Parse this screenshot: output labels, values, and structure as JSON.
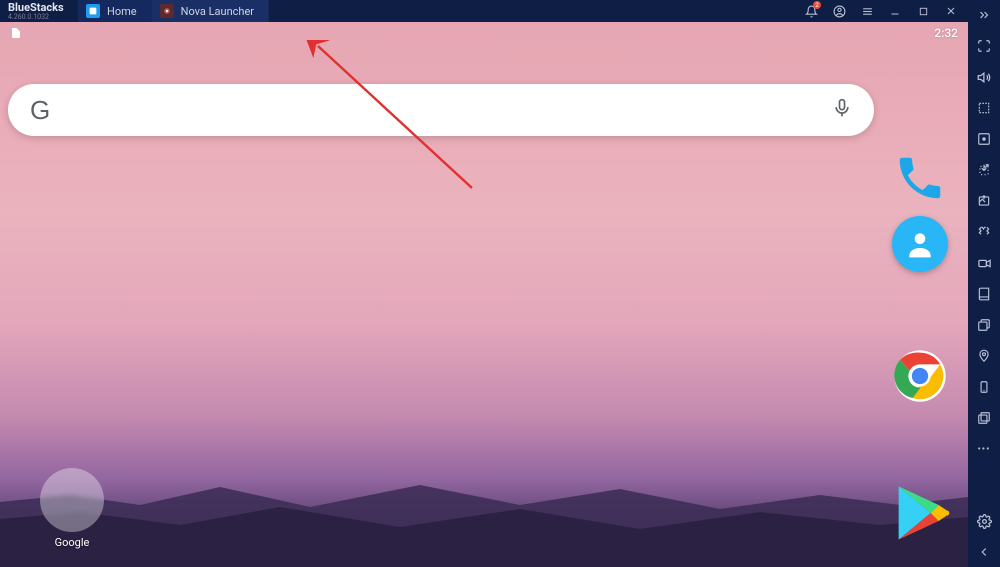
{
  "app": {
    "name": "BlueStacks",
    "version": "4.260.0.1032"
  },
  "tabs": [
    {
      "label": "Home",
      "icon": "home-app-icon"
    },
    {
      "label": "Nova Launcher",
      "icon": "nova-app-icon"
    }
  ],
  "window_controls": {
    "notification_badge": "2"
  },
  "status_bar": {
    "time": "2:32"
  },
  "search": {
    "logo": "G"
  },
  "folder": {
    "label": "Google"
  },
  "dock_apps": [
    {
      "name": "Phone"
    },
    {
      "name": "Contacts"
    },
    {
      "name": "Chrome"
    },
    {
      "name": "Play Store"
    }
  ]
}
